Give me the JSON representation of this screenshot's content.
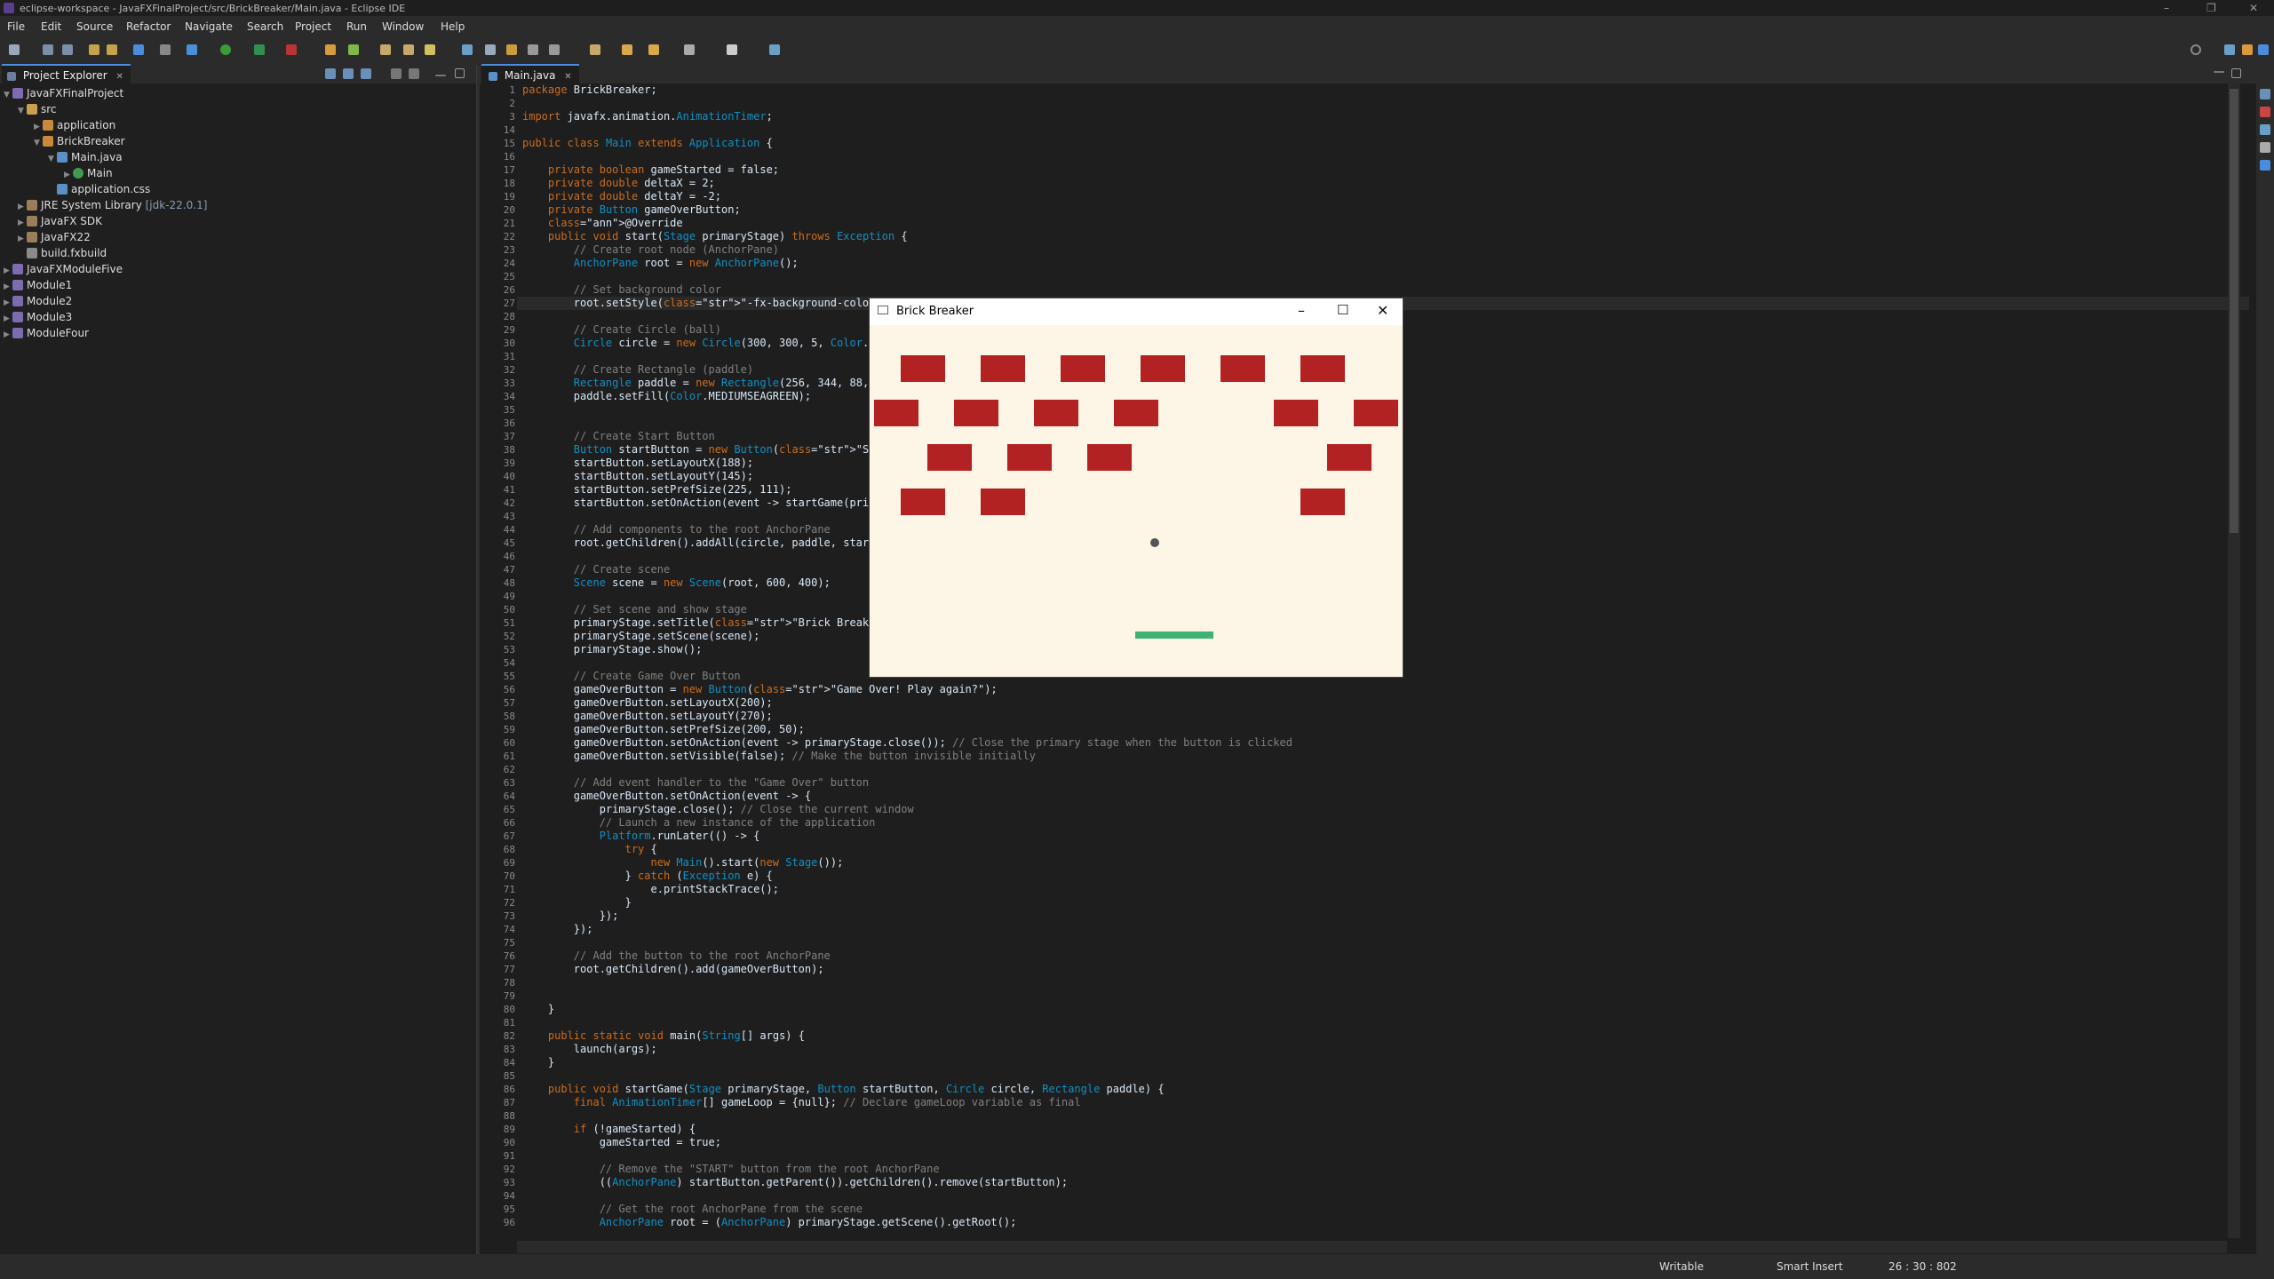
{
  "window": {
    "title": "eclipse-workspace - JavaFXFinalProject/src/BrickBreaker/Main.java - Eclipse IDE",
    "controls": [
      "–",
      "❐",
      "✕"
    ]
  },
  "menu": [
    "File",
    "Edit",
    "Source",
    "Refactor",
    "Navigate",
    "Search",
    "Project",
    "Run",
    "Window",
    "Help"
  ],
  "project_explorer": {
    "tab_label": "Project Explorer",
    "close_glyph": "✕",
    "tree": [
      {
        "label": "JavaFXFinalProject",
        "icon": "project-icon",
        "expanded": true
      },
      {
        "label": "src",
        "icon": "source-folder-icon",
        "expanded": true
      },
      {
        "label": "application",
        "icon": "package-icon",
        "expanded": false
      },
      {
        "label": "BrickBreaker",
        "icon": "package-icon",
        "expanded": true
      },
      {
        "label": "Main.java",
        "icon": "java-file-icon",
        "expanded": true
      },
      {
        "label": "Main",
        "icon": "class-icon",
        "expanded": false
      },
      {
        "label": "application.css",
        "icon": "css-file-icon",
        "expanded": null
      },
      {
        "label": "JRE System Library",
        "decoration": "[jdk-22.0.1]",
        "icon": "library-icon",
        "expanded": false
      },
      {
        "label": "JavaFX SDK",
        "icon": "library-icon",
        "expanded": false
      },
      {
        "label": "JavaFX22",
        "icon": "library-icon",
        "expanded": false
      },
      {
        "label": "build.fxbuild",
        "icon": "file-icon",
        "expanded": null
      },
      {
        "label": "JavaFXModuleFive",
        "icon": "project-icon",
        "expanded": false
      },
      {
        "label": "Module1",
        "icon": "project-icon",
        "expanded": false
      },
      {
        "label": "Module2",
        "icon": "project-icon",
        "expanded": false
      },
      {
        "label": "Module3",
        "icon": "project-icon",
        "expanded": false
      },
      {
        "label": "ModuleFour",
        "icon": "project-icon",
        "expanded": false
      }
    ]
  },
  "editor": {
    "tab_label": "Main.java",
    "close_glyph": "✕",
    "lines": [
      [
        "1",
        "package BrickBreaker;"
      ],
      [
        "2",
        ""
      ],
      [
        "3",
        "import javafx.animation.AnimationTimer;"
      ],
      [
        "14",
        ""
      ],
      [
        "15",
        "public class Main extends Application {"
      ],
      [
        "16",
        ""
      ],
      [
        "17",
        "    private boolean gameStarted = false;"
      ],
      [
        "18",
        "    private double deltaX = 2;"
      ],
      [
        "19",
        "    private double deltaY = -2;"
      ],
      [
        "20",
        "    private Button gameOverButton;"
      ],
      [
        "21",
        "    @Override"
      ],
      [
        "22",
        "    public void start(Stage primaryStage) throws Exception {"
      ],
      [
        "23",
        "        // Create root node (AnchorPane)"
      ],
      [
        "24",
        "        AnchorPane root = new AnchorPane();"
      ],
      [
        "25",
        ""
      ],
      [
        "26",
        "        // Set background color"
      ],
      [
        "27",
        "        root.setStyle(\"-fx-background-color: #FDF5E6;\");"
      ],
      [
        "28",
        ""
      ],
      [
        "29",
        "        // Create Circle (ball)"
      ],
      [
        "30",
        "        Circle circle = new Circle(300, 300, 5, Color.GRAY);"
      ],
      [
        "31",
        ""
      ],
      [
        "32",
        "        // Create Rectangle (paddle)"
      ],
      [
        "33",
        "        Rectangle paddle = new Rectangle(256, 344, 88, 10);"
      ],
      [
        "34",
        "        paddle.setFill(Color.MEDIUMSEAGREEN);"
      ],
      [
        "35",
        ""
      ],
      [
        "36",
        ""
      ],
      [
        "37",
        "        // Create Start Button"
      ],
      [
        "38",
        "        Button startButton = new Button(\"START\");"
      ],
      [
        "39",
        "        startButton.setLayoutX(188);"
      ],
      [
        "40",
        "        startButton.setLayoutY(145);"
      ],
      [
        "41",
        "        startButton.setPrefSize(225, 111);"
      ],
      [
        "42",
        "        startButton.setOnAction(event -> startGame(primaryStage, startButton, circle, paddle));"
      ],
      [
        "43",
        ""
      ],
      [
        "44",
        "        // Add components to the root AnchorPane"
      ],
      [
        "45",
        "        root.getChildren().addAll(circle, paddle, startButton);"
      ],
      [
        "46",
        ""
      ],
      [
        "47",
        "        // Create scene"
      ],
      [
        "48",
        "        Scene scene = new Scene(root, 600, 400);"
      ],
      [
        "49",
        ""
      ],
      [
        "50",
        "        // Set scene and show stage"
      ],
      [
        "51",
        "        primaryStage.setTitle(\"Brick Breaker\");"
      ],
      [
        "52",
        "        primaryStage.setScene(scene);"
      ],
      [
        "53",
        "        primaryStage.show();"
      ],
      [
        "54",
        ""
      ],
      [
        "55",
        "        // Create Game Over Button"
      ],
      [
        "56",
        "        gameOverButton = new Button(\"Game Over! Play again?\");"
      ],
      [
        "57",
        "        gameOverButton.setLayoutX(200);"
      ],
      [
        "58",
        "        gameOverButton.setLayoutY(270);"
      ],
      [
        "59",
        "        gameOverButton.setPrefSize(200, 50);"
      ],
      [
        "60",
        "        gameOverButton.setOnAction(event -> primaryStage.close()); // Close the primary stage when the button is clicked"
      ],
      [
        "61",
        "        gameOverButton.setVisible(false); // Make the button invisible initially"
      ],
      [
        "62",
        ""
      ],
      [
        "63",
        "        // Add event handler to the \"Game Over\" button"
      ],
      [
        "64",
        "        gameOverButton.setOnAction(event -> {"
      ],
      [
        "65",
        "            primaryStage.close(); // Close the current window"
      ],
      [
        "66",
        "            // Launch a new instance of the application"
      ],
      [
        "67",
        "            Platform.runLater(() -> {"
      ],
      [
        "68",
        "                try {"
      ],
      [
        "69",
        "                    new Main().start(new Stage());"
      ],
      [
        "70",
        "                } catch (Exception e) {"
      ],
      [
        "71",
        "                    e.printStackTrace();"
      ],
      [
        "72",
        "                }"
      ],
      [
        "73",
        "            });"
      ],
      [
        "74",
        "        });"
      ],
      [
        "75",
        ""
      ],
      [
        "76",
        "        // Add the button to the root AnchorPane"
      ],
      [
        "77",
        "        root.getChildren().add(gameOverButton);"
      ],
      [
        "78",
        ""
      ],
      [
        "79",
        ""
      ],
      [
        "80",
        "    }"
      ],
      [
        "81",
        ""
      ],
      [
        "82",
        "    public static void main(String[] args) {"
      ],
      [
        "83",
        "        launch(args);"
      ],
      [
        "84",
        "    }"
      ],
      [
        "85",
        ""
      ],
      [
        "86",
        "    public void startGame(Stage primaryStage, Button startButton, Circle circle, Rectangle paddle) {"
      ],
      [
        "87",
        "        final AnimationTimer[] gameLoop = {null}; // Declare gameLoop variable as final"
      ],
      [
        "88",
        ""
      ],
      [
        "89",
        "        if (!gameStarted) {"
      ],
      [
        "90",
        "            gameStarted = true;"
      ],
      [
        "91",
        ""
      ],
      [
        "92",
        "            // Remove the \"START\" button from the root AnchorPane"
      ],
      [
        "93",
        "            ((AnchorPane) startButton.getParent()).getChildren().remove(startButton);"
      ],
      [
        "94",
        ""
      ],
      [
        "95",
        "            // Get the root AnchorPane from the scene"
      ],
      [
        "96",
        "            AnchorPane root = (AnchorPane) primaryStage.getScene().getRoot();"
      ]
    ]
  },
  "game_window": {
    "title": "Brick Breaker",
    "controls": [
      "–",
      "☐",
      "✕"
    ],
    "background": "#FDF5E6",
    "brick_color": "#B22222",
    "paddle_color": "#3CB371",
    "ball_color": "#555555"
  },
  "status": {
    "writable": "Writable",
    "insert_mode": "Smart Insert",
    "position": "26 : 30 : 802"
  }
}
